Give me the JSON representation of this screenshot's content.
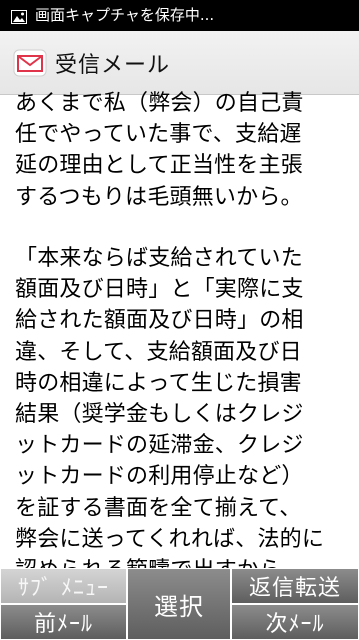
{
  "status_bar": {
    "icon": "image-icon",
    "text": "画面キャプチャを保存中..."
  },
  "header": {
    "icon": "mail-envelope-icon",
    "title": "受信メール"
  },
  "message": {
    "paragraphs": [
      {
        "lines": [
          "あくまで私（弊会）の自己責",
          "任でやっていた事で、支給遅",
          "延の理由として正当性を主張",
          "するつもりは毛頭無いから。"
        ]
      },
      {
        "lines": [
          "「本来ならば支給されていた",
          "額面及び日時」と「実際に支",
          "給された額面及び日時」の相",
          "違、そして、支給額面及び日",
          "時の相違によって生じた損害",
          "結果（奨学金もしくはクレジ",
          "ットカードの延滞金、クレジ",
          "ットカードの利用停止など）",
          "を証する書面を全て揃えて、",
          "弊会に送ってくれれば、法的に",
          "認められる範疇で出すから。"
        ]
      }
    ]
  },
  "softkeys": {
    "submenu": "ｻﾌﾞ ﾒﾆｭｰ",
    "prev_mail": "前ﾒｰﾙ",
    "select": "選択",
    "reply_forward": "返信転送",
    "next_mail": "次ﾒｰﾙ"
  }
}
